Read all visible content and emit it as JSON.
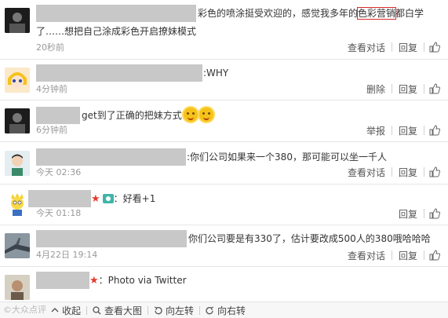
{
  "comments": [
    {
      "text_line1": "彩色的喷涂挺受欢迎的，感觉我多年的",
      "highlight": "色彩营销",
      "text_line1_after": "都白学",
      "text_line2": "了……想把自己涂成彩色开启撩妹模式",
      "time": "20秒前",
      "actions": [
        "查看对话",
        "回复"
      ]
    },
    {
      "text": ":WHY",
      "time": "4分钟前",
      "actions": [
        "删除",
        "回复"
      ]
    },
    {
      "text": "get到了正确的把妹方式",
      "time": "6分钟前",
      "actions": [
        "举报",
        "回复"
      ]
    },
    {
      "text": ":你们公司如果来一个380，那可能可以坐一千人",
      "time": "今天 02:36",
      "actions": [
        "查看对话",
        "回复"
      ]
    },
    {
      "text": "：好看+1",
      "time": "今天 01:18",
      "actions": [
        "回复"
      ]
    },
    {
      "text": "你们公司要是有330了，估计要改成500人的380哦哈哈哈",
      "time": "4月22日 19:14",
      "actions": [
        "查看对话",
        "回复"
      ]
    },
    {
      "text": "：Photo via Twitter",
      "time": "",
      "actions": []
    }
  ],
  "bottom_bar": {
    "collapse": "收起",
    "view_large": "查看大图",
    "rotate_left": "向左转",
    "rotate_right": "向右转"
  },
  "watermark": "大众点评",
  "colors": {
    "highlight_border": "#d62b2b",
    "star": "#e33b2e",
    "time_gray": "#999999"
  }
}
